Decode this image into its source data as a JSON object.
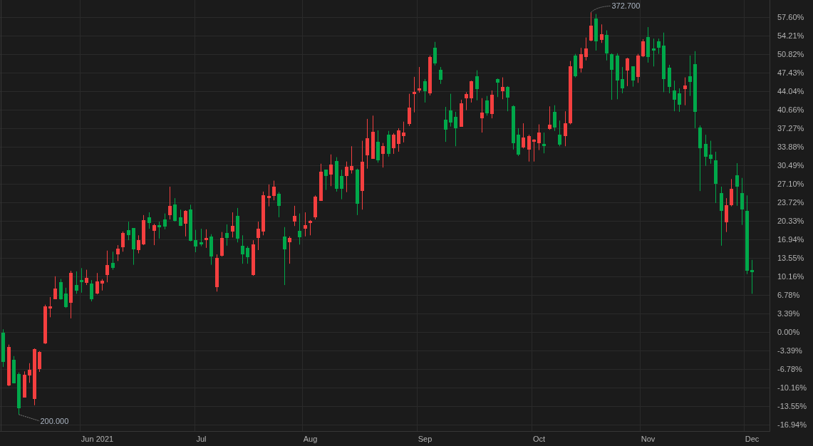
{
  "chart": {
    "chart_data": {
      "type": "candlestick",
      "categories": [
        null,
        null,
        null,
        null,
        null,
        null,
        null,
        null,
        null,
        null,
        null,
        null,
        null,
        null,
        null,
        null,
        null,
        null,
        "Jun 2021",
        null,
        null,
        null,
        null,
        null,
        null,
        null,
        null,
        null,
        null,
        null,
        null,
        null,
        null,
        null,
        null,
        null,
        null,
        null,
        "Jul",
        null,
        null,
        null,
        null,
        null,
        null,
        null,
        null,
        null,
        null,
        null,
        null,
        null,
        null,
        null,
        null,
        null,
        null,
        null,
        null,
        "Aug",
        null,
        null,
        null,
        null,
        null,
        null,
        null,
        null,
        null,
        null,
        null,
        null,
        null,
        null,
        null,
        null,
        null,
        null,
        null,
        null,
        null,
        "Sep",
        null,
        null,
        null,
        null,
        null,
        null,
        null,
        null,
        null,
        null,
        null,
        null,
        null,
        null,
        null,
        null,
        null,
        null,
        null,
        null,
        null,
        "Oct",
        null,
        null,
        null,
        null,
        null,
        null,
        null,
        null,
        null,
        null,
        null,
        null,
        null,
        null,
        null,
        null,
        null,
        null,
        null,
        null,
        "Nov",
        null,
        null,
        null,
        null,
        null,
        null,
        null,
        null,
        null,
        null,
        null,
        null,
        null,
        null,
        null,
        null,
        null,
        null,
        null,
        "Dec"
      ],
      "ohlc": [
        [
          -0.1,
          0.5,
          -6.4,
          -5.5
        ],
        [
          -9.8,
          -2.3,
          -9.9,
          -2.7
        ],
        [
          -5.1,
          -4.4,
          -9.4,
          -9.4
        ],
        [
          -7.7,
          -7.4,
          -15.1,
          -14.0
        ],
        [
          -12.0,
          -7.2,
          -12.0,
          -7.8
        ],
        [
          -8.0,
          -5.7,
          -9.3,
          -6.9
        ],
        [
          -12.3,
          -3.0,
          -13.4,
          -3.1
        ],
        [
          -6.8,
          -3.5,
          -7.3,
          -3.7
        ],
        [
          -2.1,
          5.0,
          -2.2,
          4.7
        ],
        [
          4.3,
          6.4,
          2.7,
          4.7
        ],
        [
          6.0,
          10.2,
          6.0,
          8.0
        ],
        [
          9.1,
          9.7,
          5.9,
          6.0
        ],
        [
          7.0,
          8.1,
          4.4,
          4.6
        ],
        [
          5.4,
          11.2,
          2.5,
          10.8
        ],
        [
          8.6,
          11.1,
          7.0,
          7.6
        ],
        [
          9.5,
          11.7,
          7.2,
          9.1
        ],
        [
          9.0,
          11.4,
          8.6,
          9.9
        ],
        [
          8.9,
          9.5,
          5.6,
          6.0
        ],
        [
          7.0,
          10.8,
          6.9,
          9.3
        ],
        [
          8.9,
          9.7,
          7.6,
          9.4
        ],
        [
          10.4,
          14.9,
          9.1,
          12.3
        ],
        [
          12.7,
          14.7,
          11.4,
          11.7
        ],
        [
          14.2,
          15.9,
          13.0,
          15.3
        ],
        [
          15.5,
          18.4,
          14.7,
          18.1
        ],
        [
          18.7,
          20.2,
          16.8,
          17.7
        ],
        [
          19.0,
          19.0,
          12.3,
          15.1
        ],
        [
          15.0,
          17.7,
          14.4,
          16.8
        ],
        [
          16.0,
          21.4,
          15.9,
          20.5
        ],
        [
          21.0,
          21.9,
          18.9,
          20.0
        ],
        [
          18.5,
          19.8,
          15.9,
          19.6
        ],
        [
          19.6,
          20.2,
          17.1,
          19.2
        ],
        [
          20.6,
          21.7,
          18.8,
          19.3
        ],
        [
          21.4,
          26.6,
          20.6,
          23.1
        ],
        [
          23.3,
          24.5,
          20.2,
          20.3
        ],
        [
          21.0,
          22.4,
          19.4,
          19.4
        ],
        [
          19.8,
          22.3,
          17.5,
          22.2
        ],
        [
          22.4,
          23.3,
          16.6,
          16.7
        ],
        [
          16.8,
          18.7,
          14.6,
          15.7
        ],
        [
          16.4,
          18.9,
          15.7,
          16.0
        ],
        [
          16.8,
          18.8,
          15.4,
          17.2
        ],
        [
          17.5,
          17.9,
          12.3,
          13.8
        ],
        [
          8.2,
          14.2,
          7.4,
          13.6
        ],
        [
          14.0,
          18.3,
          13.8,
          17.2
        ],
        [
          18.1,
          19.7,
          15.8,
          17.2
        ],
        [
          18.4,
          21.9,
          17.3,
          19.4
        ],
        [
          21.3,
          22.7,
          16.4,
          17.1
        ],
        [
          15.8,
          17.7,
          12.5,
          14.2
        ],
        [
          15.4,
          15.7,
          12.5,
          13.7
        ],
        [
          10.4,
          16.8,
          10.3,
          16.0
        ],
        [
          17.2,
          20.2,
          15.0,
          18.9
        ],
        [
          18.4,
          25.7,
          17.7,
          25.0
        ],
        [
          24.5,
          27.0,
          23.0,
          24.9
        ],
        [
          24.9,
          27.7,
          24.1,
          26.6
        ],
        [
          25.3,
          25.6,
          21.0,
          23.1
        ],
        [
          17.5,
          19.2,
          8.6,
          15.1
        ],
        [
          16.4,
          17.5,
          12.5,
          17.2
        ],
        [
          20.2,
          23.1,
          19.4,
          21.3
        ],
        [
          18.5,
          21.7,
          16.0,
          17.3
        ],
        [
          18.9,
          21.9,
          17.5,
          19.6
        ],
        [
          20.0,
          20.5,
          17.7,
          20.3
        ],
        [
          21.0,
          25.0,
          20.6,
          24.8
        ],
        [
          24.0,
          30.8,
          24.0,
          29.3
        ],
        [
          29.7,
          29.7,
          26.0,
          28.6
        ],
        [
          28.8,
          32.5,
          26.7,
          30.6
        ],
        [
          31.3,
          32.0,
          25.7,
          26.2
        ],
        [
          28.6,
          29.7,
          24.3,
          26.2
        ],
        [
          28.6,
          31.2,
          25.6,
          30.3
        ],
        [
          29.6,
          34.0,
          29.0,
          30.4
        ],
        [
          29.7,
          29.9,
          21.4,
          23.5
        ],
        [
          25.8,
          35.0,
          22.4,
          31.2
        ],
        [
          32.3,
          39.0,
          29.9,
          35.5
        ],
        [
          31.7,
          39.6,
          31.7,
          36.6
        ],
        [
          34.8,
          36.9,
          31.0,
          31.4
        ],
        [
          32.6,
          34.6,
          30.1,
          34.0
        ],
        [
          36.1,
          36.8,
          32.1,
          32.6
        ],
        [
          33.6,
          36.4,
          32.6,
          36.1
        ],
        [
          34.4,
          37.3,
          33.0,
          36.9
        ],
        [
          35.9,
          38.5,
          34.7,
          36.5
        ],
        [
          38.1,
          43.6,
          37.7,
          41.1
        ],
        [
          43.6,
          46.7,
          40.2,
          43.9
        ],
        [
          44.2,
          48.5,
          43.8,
          44.6
        ],
        [
          45.9,
          46.3,
          42.0,
          44.1
        ],
        [
          43.7,
          50.6,
          43.3,
          50.3
        ],
        [
          52.0,
          53.1,
          48.8,
          49.2
        ],
        [
          48.0,
          48.5,
          45.4,
          46.2
        ],
        [
          38.9,
          41.2,
          34.8,
          37.0
        ],
        [
          40.6,
          43.6,
          37.6,
          38.3
        ],
        [
          39.4,
          40.3,
          34.0,
          37.3
        ],
        [
          37.6,
          42.5,
          37.6,
          41.9
        ],
        [
          42.8,
          43.9,
          40.6,
          43.6
        ],
        [
          42.8,
          46.0,
          42.0,
          45.9
        ],
        [
          46.8,
          47.9,
          42.4,
          44.5
        ],
        [
          39.1,
          42.8,
          36.5,
          40.2
        ],
        [
          42.4,
          43.2,
          39.6,
          40.0
        ],
        [
          39.9,
          44.2,
          39.1,
          43.4
        ],
        [
          46.3,
          46.4,
          43.0,
          45.6
        ],
        [
          44.1,
          46.6,
          42.6,
          44.9
        ],
        [
          44.9,
          45.0,
          40.4,
          42.9
        ],
        [
          41.3,
          41.5,
          33.4,
          34.6
        ],
        [
          36.1,
          37.3,
          32.2,
          32.5
        ],
        [
          33.8,
          38.2,
          33.6,
          35.6
        ],
        [
          33.4,
          36.1,
          31.2,
          35.9
        ],
        [
          34.8,
          35.3,
          31.2,
          35.2
        ],
        [
          34.6,
          38.0,
          33.3,
          36.5
        ],
        [
          34.4,
          36.5,
          32.7,
          34.0
        ],
        [
          37.2,
          41.3,
          37.0,
          38.0
        ],
        [
          40.3,
          41.5,
          36.8,
          37.4
        ],
        [
          36.1,
          38.7,
          34.0,
          34.3
        ],
        [
          35.9,
          40.4,
          34.0,
          38.2
        ],
        [
          38.2,
          49.6,
          38.0,
          48.6
        ],
        [
          50.6,
          50.9,
          46.6,
          46.8
        ],
        [
          48.3,
          52.0,
          47.5,
          50.9
        ],
        [
          50.3,
          53.9,
          49.7,
          51.9
        ],
        [
          53.3,
          58.5,
          53.2,
          56.1
        ],
        [
          57.4,
          58.2,
          51.5,
          53.2
        ],
        [
          53.5,
          56.3,
          52.9,
          54.5
        ],
        [
          54.4,
          55.2,
          49.7,
          51.0
        ],
        [
          50.9,
          51.0,
          42.5,
          48.0
        ],
        [
          50.6,
          51.0,
          42.6,
          46.0
        ],
        [
          46.3,
          48.5,
          43.7,
          44.6
        ],
        [
          47.9,
          50.2,
          45.0,
          50.1
        ],
        [
          48.6,
          48.6,
          44.9,
          46.0
        ],
        [
          46.7,
          50.9,
          45.6,
          50.6
        ],
        [
          50.5,
          53.6,
          50.3,
          53.2
        ],
        [
          54.0,
          55.8,
          49.3,
          50.3
        ],
        [
          51.9,
          53.7,
          48.6,
          51.5
        ],
        [
          53.2,
          53.7,
          50.9,
          52.0
        ],
        [
          52.4,
          54.8,
          43.9,
          46.3
        ],
        [
          48.4,
          48.9,
          43.7,
          44.9
        ],
        [
          44.2,
          46.0,
          40.4,
          42.5
        ],
        [
          43.7,
          44.6,
          40.3,
          41.6
        ],
        [
          44.5,
          46.6,
          41.5,
          45.1
        ],
        [
          46.8,
          50.6,
          43.2,
          45.8
        ],
        [
          49.0,
          51.4,
          37.3,
          40.3
        ],
        [
          37.4,
          37.8,
          25.8,
          33.6
        ],
        [
          34.4,
          36.1,
          30.4,
          32.1
        ],
        [
          32.5,
          35.0,
          30.8,
          31.7
        ],
        [
          31.4,
          33.0,
          23.6,
          27.1
        ],
        [
          25.4,
          26.6,
          15.8,
          22.2
        ],
        [
          20.1,
          24.5,
          18.3,
          23.2
        ],
        [
          23.2,
          28.0,
          23.0,
          26.2
        ],
        [
          28.7,
          30.9,
          23.1,
          26.6
        ],
        [
          25.4,
          28.2,
          19.6,
          22.4
        ],
        [
          22.2,
          25.0,
          10.6,
          11.2
        ],
        [
          11.4,
          13.2,
          7.0,
          11.0
        ]
      ],
      "ylim": [
        -18.25,
        60.76
      ],
      "grid": true,
      "yticks": [
        {
          "value": 57.6,
          "label": "57.60%"
        },
        {
          "value": 54.21,
          "label": "54.21%"
        },
        {
          "value": 50.82,
          "label": "50.82%"
        },
        {
          "value": 47.43,
          "label": "47.43%"
        },
        {
          "value": 44.04,
          "label": "44.04%"
        },
        {
          "value": 40.66,
          "label": "40.66%"
        },
        {
          "value": 37.27,
          "label": "37.27%"
        },
        {
          "value": 33.88,
          "label": "33.88%"
        },
        {
          "value": 30.49,
          "label": "30.49%"
        },
        {
          "value": 27.1,
          "label": "27.10%"
        },
        {
          "value": 23.72,
          "label": "23.72%"
        },
        {
          "value": 20.33,
          "label": "20.33%"
        },
        {
          "value": 16.94,
          "label": "16.94%"
        },
        {
          "value": 13.55,
          "label": "13.55%"
        },
        {
          "value": 10.16,
          "label": "10.16%"
        },
        {
          "value": 6.78,
          "label": "6.78%"
        },
        {
          "value": 3.39,
          "label": "3.39%"
        },
        {
          "value": 0,
          "label": "0.00%"
        },
        {
          "value": -3.39,
          "label": "-3.39%"
        },
        {
          "value": -6.78,
          "label": "-6.78%"
        },
        {
          "value": -10.16,
          "label": "-10.16%"
        },
        {
          "value": -13.55,
          "label": "-13.55%"
        },
        {
          "value": -16.94,
          "label": "-16.94%"
        }
      ],
      "annotations": [
        "372.700",
        "200.000"
      ]
    }
  }
}
